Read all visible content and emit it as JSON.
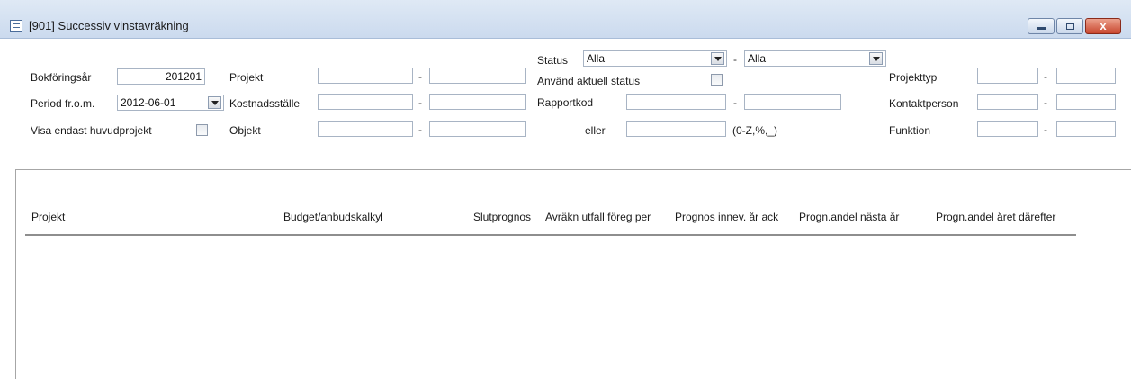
{
  "window": {
    "title": "[901]  Successiv vinstavräkning",
    "minimize_label": "",
    "maximize_label": "",
    "close_label": "x"
  },
  "filters": {
    "bokforingsar": {
      "label": "Bokföringsår",
      "value": "201201"
    },
    "period": {
      "label": "Period fr.o.m.",
      "value": "2012-06-01"
    },
    "visa_huvudprojekt": {
      "label": "Visa endast huvudprojekt",
      "checked": false
    },
    "projekt": {
      "label": "Projekt",
      "from": "",
      "to": ""
    },
    "kostnadsstalle": {
      "label": "Kostnadsställe",
      "from": "",
      "to": ""
    },
    "objekt": {
      "label": "Objekt",
      "from": "",
      "to": ""
    },
    "status": {
      "label": "Status",
      "from": "Alla",
      "to": "Alla"
    },
    "anvand_aktuell_status": {
      "label": "Använd aktuell status",
      "checked": false
    },
    "rapportkod": {
      "label": "Rapportkod",
      "from": "",
      "to": ""
    },
    "eller": {
      "label": "eller",
      "value": "",
      "hint": "(0-Z,%,_)"
    },
    "projekttyp": {
      "label": "Projekttyp",
      "from": "",
      "to": ""
    },
    "kontaktperson": {
      "label": "Kontaktperson",
      "from": "",
      "to": ""
    },
    "funktion": {
      "label": "Funktion",
      "from": "",
      "to": ""
    },
    "range_separator": "-"
  },
  "table": {
    "columns": [
      "Projekt",
      "Budget/anbudskalkyl",
      "Slutprognos",
      "Avräkn utfall föreg per",
      "Prognos innev. år ack",
      "Progn.andel nästa år",
      "Progn.andel året därefter"
    ],
    "rows": []
  }
}
